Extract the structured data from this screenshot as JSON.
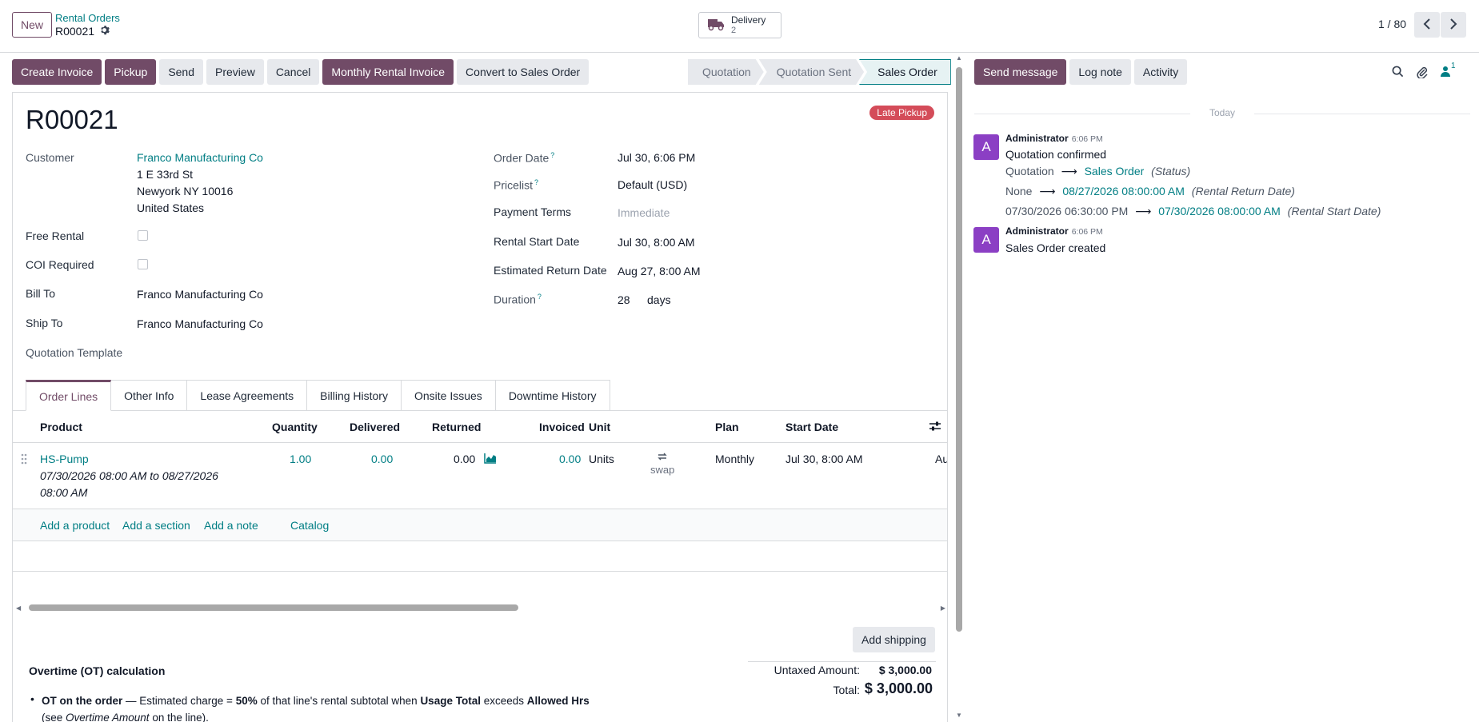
{
  "header": {
    "new_label": "New",
    "breadcrumb_parent": "Rental Orders",
    "breadcrumb_current": "R00021",
    "delivery_label": "Delivery",
    "delivery_count": "2",
    "pager": "1 / 80"
  },
  "actions": [
    "Create Invoice",
    "Pickup",
    "Send",
    "Preview",
    "Cancel",
    "Monthly Rental Invoice",
    "Convert to Sales Order"
  ],
  "stages": [
    "Quotation",
    "Quotation Sent",
    "Sales Order"
  ],
  "form": {
    "name": "R00021",
    "badge": "Late Pickup",
    "customer_label": "Customer",
    "customer_name": "Franco Manufacturing Co",
    "address1": "1 E 33rd St",
    "address2": "Newyork NY 10016",
    "address3": "United States",
    "free_rental_label": "Free Rental",
    "coi_label": "COI Required",
    "bill_to_label": "Bill To",
    "bill_to": "Franco Manufacturing Co",
    "ship_to_label": "Ship To",
    "ship_to": "Franco Manufacturing Co",
    "quotation_template_label": "Quotation Template",
    "order_date_label": "Order Date",
    "order_date": "Jul 30, 6:06 PM",
    "pricelist_label": "Pricelist",
    "pricelist": "Default (USD)",
    "payment_terms_label": "Payment Terms",
    "payment_terms": "Immediate",
    "rental_start_label": "Rental Start Date",
    "rental_start": "Jul 30, 8:00 AM",
    "est_return_label": "Estimated Return Date",
    "est_return": "Aug 27, 8:00 AM",
    "duration_label": "Duration",
    "duration_value": "28",
    "duration_unit": "days",
    "help_mark": "?"
  },
  "tabs": [
    "Order Lines",
    "Other Info",
    "Lease Agreements",
    "Billing History",
    "Onsite Issues",
    "Downtime History"
  ],
  "lines": {
    "columns": {
      "product": "Product",
      "quantity": "Quantity",
      "delivered": "Delivered",
      "returned": "Returned",
      "invoiced": "Invoiced",
      "unit": "Unit",
      "plan": "Plan",
      "start_date": "Start Date"
    },
    "row": {
      "product": "HS-Pump",
      "description1": "07/30/2026 08:00 AM to 08/27/2026",
      "description2": "08:00 AM",
      "quantity": "1.00",
      "delivered": "0.00",
      "returned": "0.00",
      "invoiced": "0.00",
      "unit": "Units",
      "swap": "swap",
      "plan": "Monthly",
      "start_date": "Jul 30, 8:00 AM",
      "cut_text": "Au"
    },
    "add_product": "Add a product",
    "add_section": "Add a section",
    "add_note": "Add a note",
    "catalog": "Catalog"
  },
  "totals": {
    "add_shipping": "Add shipping",
    "untaxed_label": "Untaxed Amount:",
    "untaxed_value": "$ 3,000.00",
    "total_label": "Total:",
    "total_value": "$ 3,000.00"
  },
  "overtime": {
    "title": "Overtime (OT) calculation",
    "b1": "OT on the order",
    "t1": " — Estimated charge = ",
    "b2": "50%",
    "t2": " of that line's rental subtotal when ",
    "b3": "Usage Total",
    "t3": " exceeds ",
    "b4": "Allowed Hrs",
    "t4": "(see ",
    "i1": "Overtime Amount",
    "t5": " on the line)."
  },
  "chatter": {
    "send_message": "Send message",
    "log_note": "Log note",
    "activity": "Activity",
    "followers_count": "1",
    "today": "Today",
    "messages": [
      {
        "avatar": "A",
        "author": "Administrator",
        "time": "6:06 PM",
        "body": "Quotation confirmed",
        "tracking": [
          {
            "old": "Quotation",
            "new": "Sales Order",
            "field": "(Status)"
          },
          {
            "old": "None",
            "new": "08/27/2026 08:00:00 AM",
            "field": "(Rental Return Date)"
          },
          {
            "old": "07/30/2026 06:30:00 PM",
            "new": "07/30/2026 08:00:00 AM",
            "field": "(Rental Start Date)"
          }
        ]
      },
      {
        "avatar": "A",
        "author": "Administrator",
        "time": "6:06 PM",
        "body": "Sales Order created"
      }
    ]
  },
  "colors": {
    "primary": "#714b67",
    "link": "#017e84",
    "badge": "#d44c59",
    "avatar": "#8b3fc4"
  },
  "icons": [
    "gear-icon",
    "truck-icon",
    "chevron-left-icon",
    "chevron-right-icon",
    "drag-handle-icon",
    "forecast-chart-icon",
    "swap-icon",
    "optional-columns-icon",
    "search-icon",
    "paperclip-icon",
    "followers-icon",
    "arrow-right-icon"
  ]
}
